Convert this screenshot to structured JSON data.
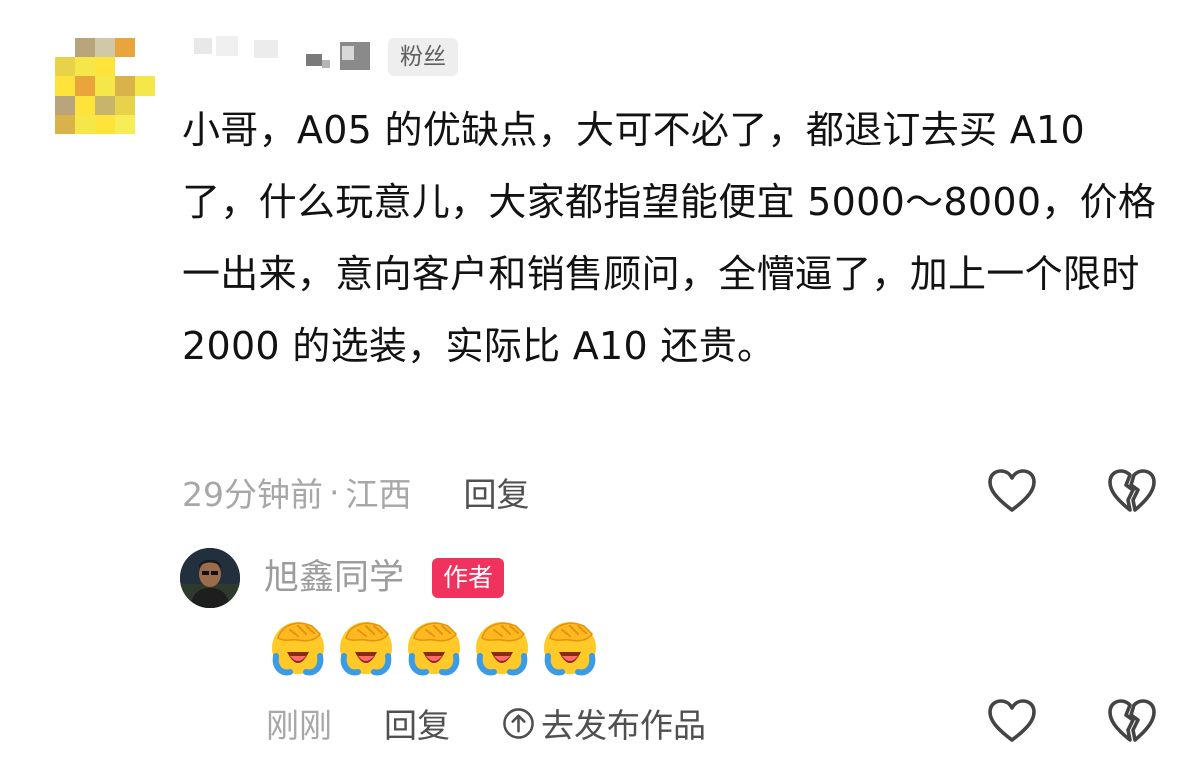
{
  "comment": {
    "fan_badge": "粉丝",
    "text": "小哥，A05 的优缺点，大可不必了，都退订去买 A10 了，什么玩意儿，大家都指望能便宜 5000～8000，价格一出来，意向客户和销售顾问，全懵逼了，加上一个限时 2000 的选装，实际比 A10 还贵。",
    "time": "29分钟前",
    "separator": "·",
    "location": "江西",
    "reply_label": "回复"
  },
  "reply": {
    "author_name": "旭鑫同学",
    "author_badge": "作者",
    "emoji": "face-palm-crying-emoji",
    "emoji_count": 5,
    "time": "刚刚",
    "reply_label": "回复",
    "share_label": "去发布作品"
  },
  "icons": [
    "heart-outline-icon",
    "broken-heart-icon",
    "arrow-up-circle-icon"
  ],
  "colors": {
    "author_badge": "#f0325e",
    "meta_text": "#a7a7a7",
    "action_text": "#505050"
  }
}
